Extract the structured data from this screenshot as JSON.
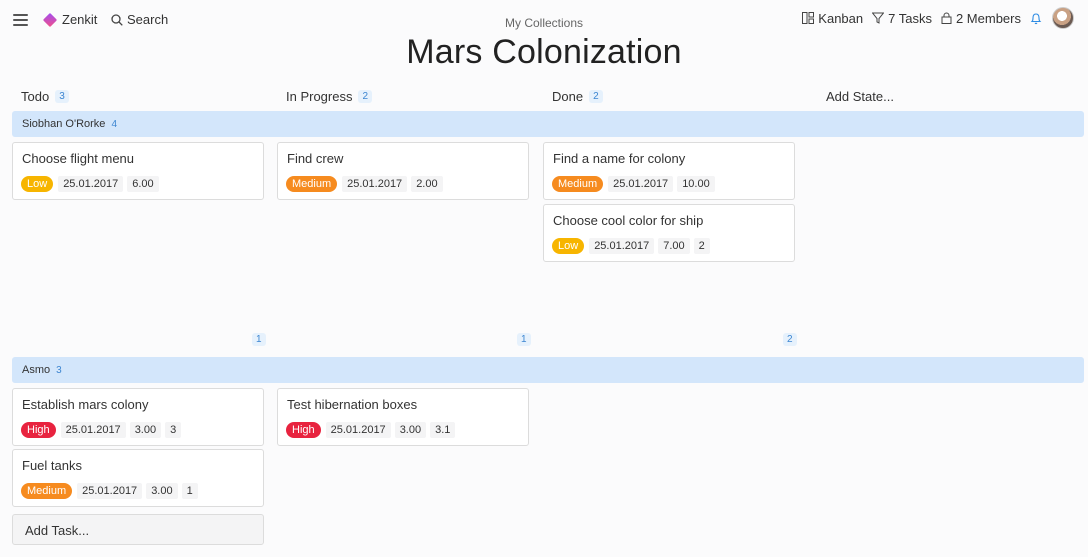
{
  "header": {
    "app_name": "Zenkit",
    "search_label": "Search",
    "breadcrumb": "My Collections",
    "title": "Mars Colonization",
    "view_label": "Kanban",
    "filter_label": "7 Tasks",
    "members_label": "2 Members"
  },
  "columns": [
    {
      "label": "Todo",
      "count": "3"
    },
    {
      "label": "In Progress",
      "count": "2"
    },
    {
      "label": "Done",
      "count": "2"
    }
  ],
  "add_state_label": "Add State...",
  "priority_colors": {
    "Low": "#f7b500",
    "Medium": "#f68b1f",
    "High": "#e8233f"
  },
  "lanes": [
    {
      "name": "Siobhan O'Rorke",
      "count": "4",
      "footer_counts": [
        "1",
        "1",
        "2"
      ],
      "cards": [
        {
          "title": "Choose flight menu",
          "priority": "Low",
          "date": "25.01.2017",
          "value": "6.00",
          "extra": ""
        },
        {
          "title": "Find crew",
          "priority": "Medium",
          "date": "25.01.2017",
          "value": "2.00",
          "extra": ""
        },
        {
          "title": "Find a name for colony",
          "priority": "Medium",
          "date": "25.01.2017",
          "value": "10.00",
          "extra": ""
        },
        {
          "title": "Choose cool color for ship",
          "priority": "Low",
          "date": "25.01.2017",
          "value": "7.00",
          "extra": "2"
        }
      ]
    },
    {
      "name": "Asmo",
      "count": "3",
      "cards": [
        {
          "title": "Establish mars colony",
          "priority": "High",
          "date": "25.01.2017",
          "value": "3.00",
          "extra": "3"
        },
        {
          "title": "Test hibernation boxes",
          "priority": "High",
          "date": "25.01.2017",
          "value": "3.00",
          "extra": "3.1"
        },
        {
          "title": "Fuel tanks",
          "priority": "Medium",
          "date": "25.01.2017",
          "value": "3.00",
          "extra": "1"
        }
      ]
    }
  ],
  "add_task_label": "Add Task..."
}
